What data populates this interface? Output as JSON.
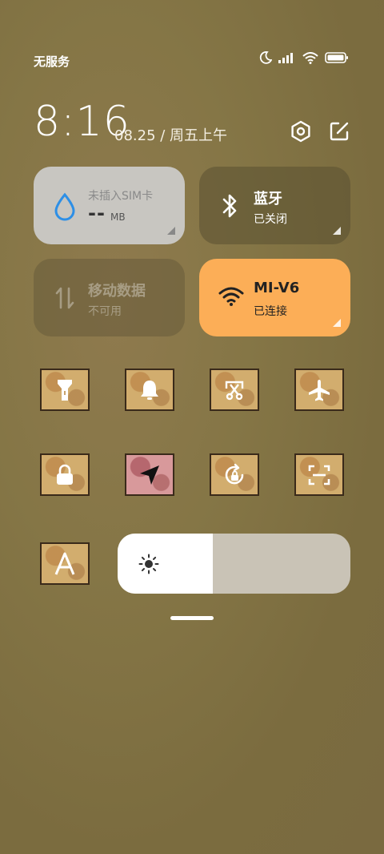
{
  "status_bar": {
    "carrier": "无服务",
    "icons": [
      "moon-icon",
      "signal-icon",
      "wifi-icon",
      "battery-icon"
    ]
  },
  "header": {
    "time": "8:16",
    "date": "08.25 / 周五上午",
    "icons": [
      "settings-icon",
      "edit-icon"
    ]
  },
  "tiles": {
    "sim": {
      "title": "未插入SIM卡",
      "value": "--",
      "unit": "MB",
      "icon": "droplet-icon"
    },
    "bluetooth": {
      "title": "蓝牙",
      "sub": "已关闭",
      "icon": "bluetooth-icon"
    },
    "mobile_data": {
      "title": "移动数据",
      "sub": "不可用",
      "icon": "data-arrows-icon"
    },
    "wifi": {
      "title": "MI-V6",
      "sub": "已连接",
      "icon": "wifi-icon",
      "color": "#fcae57"
    }
  },
  "toggles": [
    {
      "name": "flashlight",
      "icon": "flashlight-icon",
      "active": false
    },
    {
      "name": "silent",
      "icon": "bell-icon",
      "active": false
    },
    {
      "name": "screenshot",
      "icon": "scissors-icon",
      "active": false
    },
    {
      "name": "airplane",
      "icon": "airplane-icon",
      "active": false
    },
    {
      "name": "lock",
      "icon": "lock-icon",
      "active": false
    },
    {
      "name": "location",
      "icon": "location-arrow-icon",
      "active": true
    },
    {
      "name": "rotation-lock",
      "icon": "rotation-lock-icon",
      "active": false
    },
    {
      "name": "scanner",
      "icon": "scan-icon",
      "active": false
    },
    {
      "name": "reading-mode",
      "icon": "letter-a-icon",
      "active": false
    }
  ],
  "brightness": {
    "level": 0.41,
    "icon": "sun-icon"
  }
}
